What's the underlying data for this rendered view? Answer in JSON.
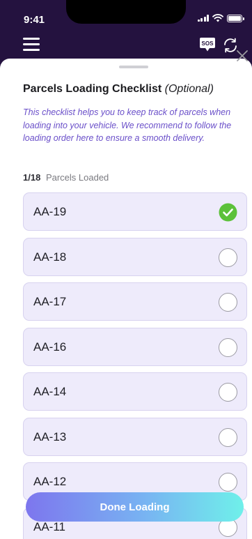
{
  "status_bar": {
    "time": "9:41"
  },
  "header": {
    "sos_label": "SOS"
  },
  "sheet": {
    "title": "Parcels Loading Checklist",
    "title_optional": "(Optional)",
    "helper_text": "This checklist helps you to keep track of parcels when loading into your vehicle. We recommend to follow the loading order here to ensure a smooth delivery.",
    "progress_count": "1/18",
    "progress_label": "Parcels Loaded"
  },
  "parcels": [
    {
      "code": "AA-19",
      "checked": true
    },
    {
      "code": "AA-18",
      "checked": false
    },
    {
      "code": "AA-17",
      "checked": false
    },
    {
      "code": "AA-16",
      "checked": false
    },
    {
      "code": "AA-14",
      "checked": false
    },
    {
      "code": "AA-13",
      "checked": false
    },
    {
      "code": "AA-12",
      "checked": false
    },
    {
      "code": "AA-11",
      "checked": false
    }
  ],
  "done_button": {
    "label": "Done Loading"
  },
  "colors": {
    "accent": "#6a4fc9",
    "header_bg": "#24123f",
    "check_green": "#5cc13a",
    "item_bg": "#eeebfb"
  }
}
